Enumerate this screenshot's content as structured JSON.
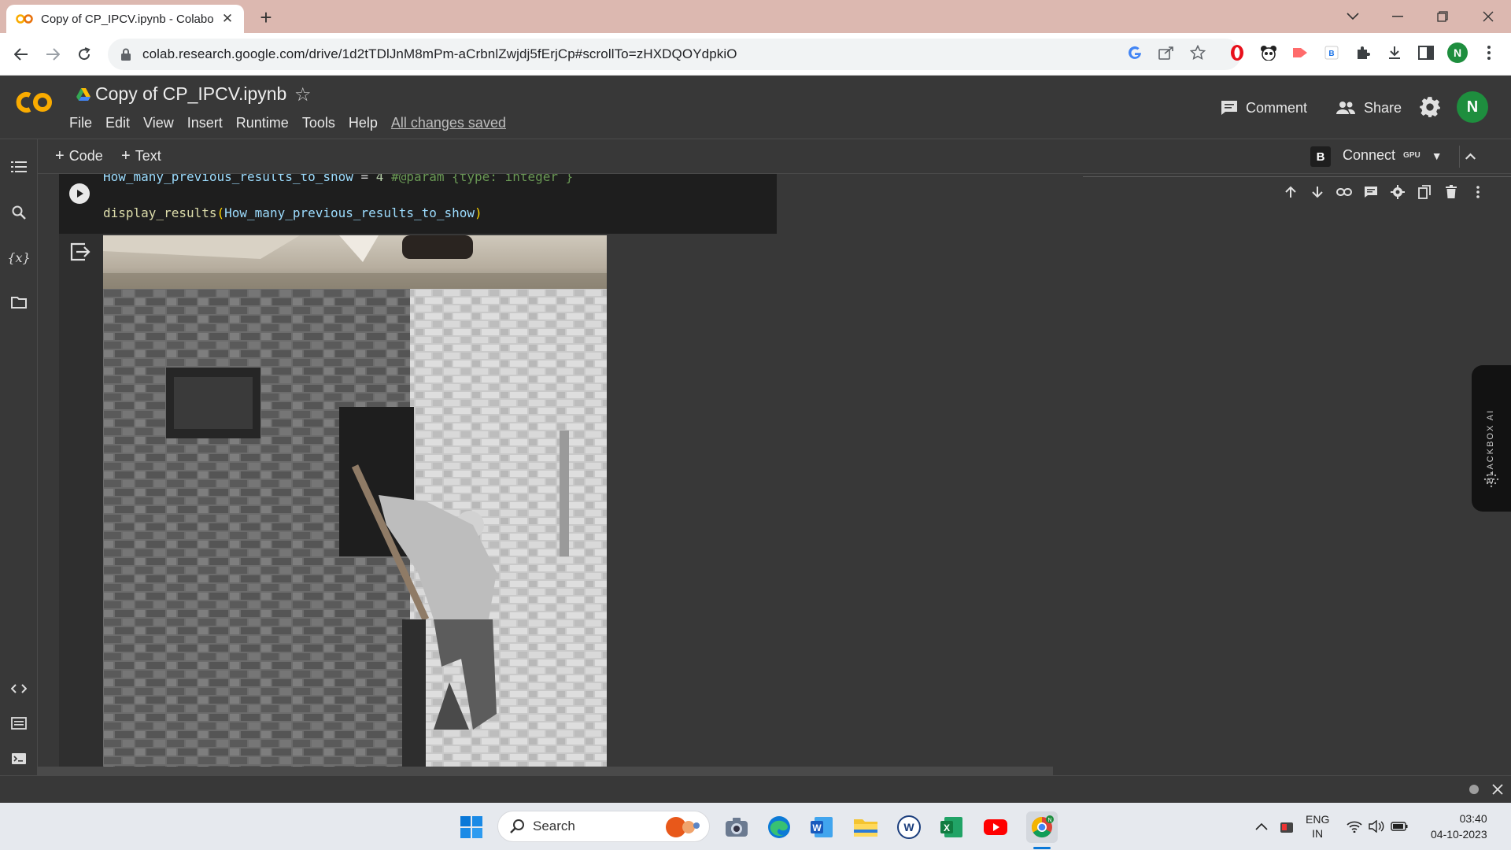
{
  "browser": {
    "tab_title": "Copy of CP_IPCV.ipynb - Colabo",
    "url": "colab.research.google.com/drive/1d2tTDlJnM8mPm-aCrbnlZwjdj5fErjCp#scrollTo=zHXDQOYdpkiO",
    "profile_initial": "N"
  },
  "colab": {
    "notebook_title": "Copy of CP_IPCV.ipynb",
    "menu": [
      "File",
      "Edit",
      "View",
      "Insert",
      "Runtime",
      "Tools",
      "Help"
    ],
    "save_status": "All changes saved",
    "comment_label": "Comment",
    "share_label": "Share",
    "user_initial": "N",
    "add_code_label": "Code",
    "add_text_label": "Text",
    "ext_badge": "B",
    "connect_label": "Connect",
    "runtime_type": "GPU"
  },
  "cell": {
    "line1_var": "How_many_previous_results_to_show",
    "line1_op": " = ",
    "line1_val": "4",
    "line1_comment": " #@param {type: integer }",
    "line2_func": "display_results",
    "line2_paren_open": "(",
    "line2_arg": "How_many_previous_results_to_show",
    "line2_paren_close": ")"
  },
  "blackbox": {
    "label": "BLACKBOX AI"
  },
  "taskbar": {
    "search_label": "Search",
    "lang_line1": "ENG",
    "lang_line2": "IN",
    "time": "03:40",
    "date": "04-10-2023"
  },
  "colors": {
    "colab_bg": "#383838",
    "code_bg": "#1e1e1e",
    "tab_strip": "#dcb8b0",
    "code_string": "#ce9178",
    "code_comment": "#6a9955",
    "code_number": "#b5cea8"
  }
}
